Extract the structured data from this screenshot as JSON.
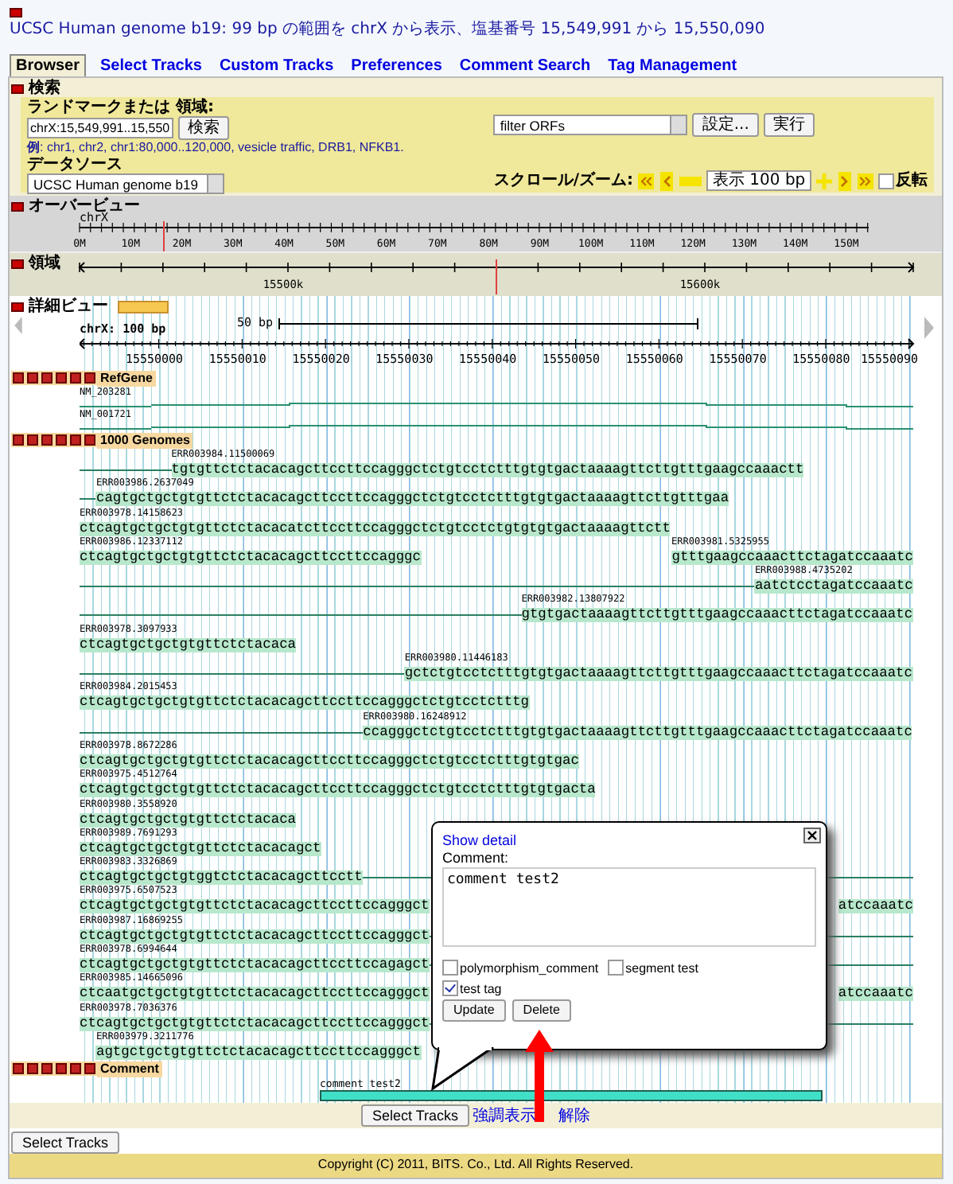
{
  "title": "UCSC Human genome b19: 99 bp の範囲を chrX から表示、塩基番号 15,549,991 から 15,550,090",
  "tabs": [
    {
      "label": "Browser",
      "selected": true
    },
    {
      "label": "Select Tracks",
      "selected": false
    },
    {
      "label": "Custom Tracks",
      "selected": false
    },
    {
      "label": "Preferences",
      "selected": false
    },
    {
      "label": "Comment Search",
      "selected": false
    },
    {
      "label": "Tag Management",
      "selected": false
    }
  ],
  "search": {
    "heading": "検索",
    "landmark_label": "ランドマークまたは 領域:",
    "landmark_value": "chrX:15,549,991..15,550",
    "search_button": "検索",
    "examples": "**例**: chr1, chr2, chr1:80,000..120,000, vesicle traffic, DRB1, NFKB1.",
    "source_label": "データソース",
    "source_value": "UCSC Human genome b19",
    "filter_value": "filter ORFs",
    "settings_button": "設定...",
    "run_button": "実行",
    "zoom_label": "スクロール/ズーム:",
    "zoom_value": "表示 100 bp",
    "reverse": {
      "label": "反転",
      "checked": false
    }
  },
  "overview": {
    "heading": "オーバービュー",
    "chrom": "chrX",
    "ticks": [
      "0M",
      "10M",
      "20M",
      "30M",
      "40M",
      "50M",
      "60M",
      "70M",
      "80M",
      "90M",
      "100M",
      "110M",
      "120M",
      "130M",
      "140M",
      "150M"
    ]
  },
  "region": {
    "heading": "領域",
    "ticks": [
      "15500k",
      "15600k"
    ]
  },
  "detail": {
    "heading": "詳細ビュー",
    "size_label": "chrX: 100 bp",
    "scale_label": "50 bp",
    "ticks": [
      "15550000",
      "15550010",
      "15550020",
      "15550030",
      "15550040",
      "15550050",
      "15550060",
      "15550070",
      "15550080",
      "15550090"
    ]
  },
  "refgene": {
    "name": "RefGene",
    "genes": [
      "NM_203281",
      "NM_001721"
    ]
  },
  "genomes": {
    "name": "1000 Genomes",
    "rows": [
      [
        {
          "label": "ERR003984.11500069",
          "kind": "leading",
          "level": 0.11,
          "seq": "tgtgttctctacacagcttccttccagggctctgtcctctttgtgtgactaaaagttcttgtttgaagccaaactt"
        }
      ],
      [
        {
          "label": "ERR003986.2637049",
          "kind": "leading",
          "level": 0.02,
          "seq": "cagtgctgctgtgttctctacacagcttccttccagggctctgtcctctttgtgtgactaaaagttcttgtttgaa"
        }
      ],
      [
        {
          "label": "ERR003978.14158623",
          "kind": "plain",
          "seq": "ctcagtgctgctgtgttctctacacatcttccttccagggctctgtcctctgtgtgtgactaaaagttctt"
        }
      ],
      [
        {
          "label": "ERR003986.12337112",
          "kind": "plain",
          "seq": "ctcagtgctgctgtgttctctacacagcttccttccagggc"
        },
        {
          "label": "ERR003981.5325955",
          "kind": "right",
          "seq": "gtttgaagccaaacttctagatccaaatc"
        }
      ],
      [
        {
          "label": "ERR003988.4735202",
          "kind": "leading",
          "level": 0.81,
          "seq": "aatctcctagatccaaatc"
        }
      ],
      [
        {
          "label": "ERR003982.13807922",
          "kind": "leading",
          "level": 0.53,
          "seq": "gtgtgactaaaagttcttgtttgaagccaaacttctagatccaaatc"
        }
      ],
      [
        {
          "label": "ERR003978.3097933",
          "kind": "plain",
          "seq": "ctcagtgctgctgtgttctctacaca"
        }
      ],
      [
        {
          "label": "ERR003980.11446183",
          "kind": "leading",
          "level": 0.39,
          "seq": "gctctgtcctctttgtgtgactaaaagttcttgtttgaagccaaacttctagatccaaatc"
        }
      ],
      [
        {
          "label": "ERR003984.2015453",
          "kind": "plain",
          "seq": "ctcagtgctgctgtgttctctacacagcttccttccagggctctgtcctctttg"
        }
      ],
      [
        {
          "label": "ERR003980.16248912",
          "kind": "leading",
          "level": 0.34,
          "seq": "ccagggctctgtcctctttgtgtgactaaaagttcttgtttgaagccaaacttctagatccaaatc"
        }
      ],
      [
        {
          "label": "ERR003978.8672286",
          "kind": "plain",
          "seq": "ctcagtgctgctgtgttctctacacagcttccttccagggctctgtcctctttgtgtgac"
        }
      ],
      [
        {
          "label": "ERR003975.4512764",
          "kind": "plain",
          "seq": "ctcagtgctgctgtgttctctacacagcttccttccagggctctgtcctctttgtgtgacta"
        }
      ],
      [
        {
          "label": "ERR003980.3558920",
          "kind": "plain",
          "seq": "ctcagtgctgctgtgttctctacaca"
        }
      ],
      [
        {
          "label": "ERR003989.7691293",
          "kind": "plain",
          "seq": "ctcagtgctgctgtgttctctacacagct"
        }
      ],
      [
        {
          "label": "ERR003983.3326869",
          "kind": "trailing",
          "seq": "ctcagtgctgctgtggtctctacacagcttcctt"
        }
      ],
      [
        {
          "label": "ERR003975.6507523",
          "kind": "plain",
          "seq": "ctcagtgctgctgtgttctctacacagcttccttccagggct"
        },
        {
          "kind": "right",
          "seq": "atccaaatc"
        }
      ],
      [
        {
          "label": "ERR003987.16869255",
          "kind": "trailing",
          "seq": "ctcagtgctgctgtgttctctacacagcttccttccagggct"
        }
      ],
      [
        {
          "label": "ERR003978.6994644",
          "kind": "trailing",
          "seq": "ctcagtgctgctgtgttctctacacagcttccttccagagct"
        }
      ],
      [
        {
          "label": "ERR003985.14665096",
          "kind": "plain",
          "seq": "ctcaatgctgctgtgttctctacacagcttccttccagggct"
        },
        {
          "kind": "right",
          "seq": "atccaaatc"
        }
      ],
      [
        {
          "label": "ERR003978.7036376",
          "kind": "trailing",
          "seq": "ctcagtgctgctgtgttctctacacagcttccttccagggct"
        }
      ],
      [
        {
          "label": "ERR003979.3211776",
          "kind": "plain",
          "level": 0.02,
          "seq": "agtgctgctgtgttctctacacagcttccttccagggct"
        }
      ]
    ]
  },
  "comment_track": {
    "name": "Comment",
    "label": "comment test2"
  },
  "popup": {
    "link": "Show detail",
    "comment_label": "Comment:",
    "comment_value": "comment test2",
    "tags": [
      {
        "label": "polymorphism_comment",
        "checked": false
      },
      {
        "label": "segment test",
        "checked": false
      },
      {
        "label": "test tag",
        "checked": true
      }
    ],
    "update_button": "Update",
    "delete_button": "Delete"
  },
  "bottom": {
    "select_button": "Select Tracks",
    "clear_link_parts": [
      "強調表示",
      "解除"
    ],
    "select_button_2": "Select Tracks"
  },
  "footer": "Copyright (C) 2011, BITS. Co., Ltd. All Rights Reserved."
}
